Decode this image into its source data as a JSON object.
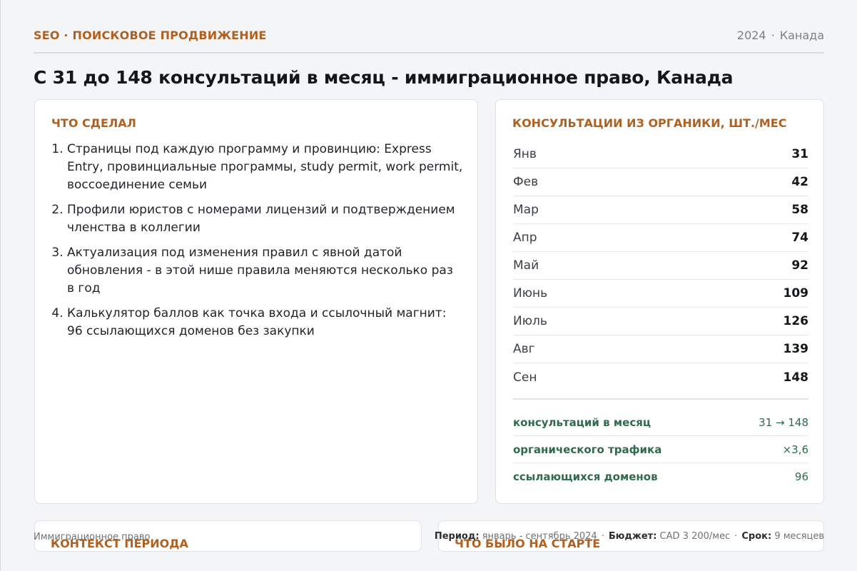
{
  "header": {
    "eyebrow": "SEO · ПОИСКОВОЕ ПРОДВИЖЕНИЕ",
    "year": "2024",
    "separator": "·",
    "country": "Канада"
  },
  "title": "С 31 до 148 консультаций в месяц - иммиграционное право, Канада",
  "actions": {
    "title": "ЧТО СДЕЛАЛ",
    "items": [
      "Страницы под каждую программу и провинцию: Express Entry, провинциальные программы, study permit, work permit, воссоединение семьи",
      "Профили юристов с номерами лицензий и подтверждением членства в коллегии",
      "Актуализация под изменения правил с явной датой обновления - в этой нише правила меняются несколько раз в год",
      "Калькулятор баллов как точка входа и ссылочный магнит: 96 ссылающихся доменов без закупки"
    ]
  },
  "consultations": {
    "title": "КОНСУЛЬТАЦИИ ИЗ ОРГАНИКИ, ШТ./МЕС",
    "months": [
      {
        "month": "Янв",
        "value": "31"
      },
      {
        "month": "Фев",
        "value": "42"
      },
      {
        "month": "Мар",
        "value": "58"
      },
      {
        "month": "Апр",
        "value": "74"
      },
      {
        "month": "Май",
        "value": "92"
      },
      {
        "month": "Июнь",
        "value": "109"
      },
      {
        "month": "Июль",
        "value": "126"
      },
      {
        "month": "Авг",
        "value": "139"
      },
      {
        "month": "Сен",
        "value": "148"
      }
    ],
    "kpis": [
      {
        "label": "консультаций в месяц",
        "value": "31 → 148"
      },
      {
        "label": "органического трафика",
        "value": "×3,6"
      },
      {
        "label": "ссылающихся доменов",
        "value": "96"
      }
    ]
  },
  "bottom": {
    "context_title": "КОНТЕКСТ ПЕРИОДА",
    "start_title": "ЧТО БЫЛО НА СТАРТЕ"
  },
  "footer": {
    "niche": "Иммиграционное право",
    "period_label": "Период:",
    "period_value": "январь - сентябрь 2024",
    "budget_label": "Бюджет:",
    "budget_value": "CAD 3 200/мес",
    "term_label": "Срок:",
    "term_value": "9 месяцев",
    "separator": "·"
  },
  "colors": {
    "accent": "#b06020",
    "kpi_green": "#2f6b4c",
    "background": "#f4f5f7"
  }
}
